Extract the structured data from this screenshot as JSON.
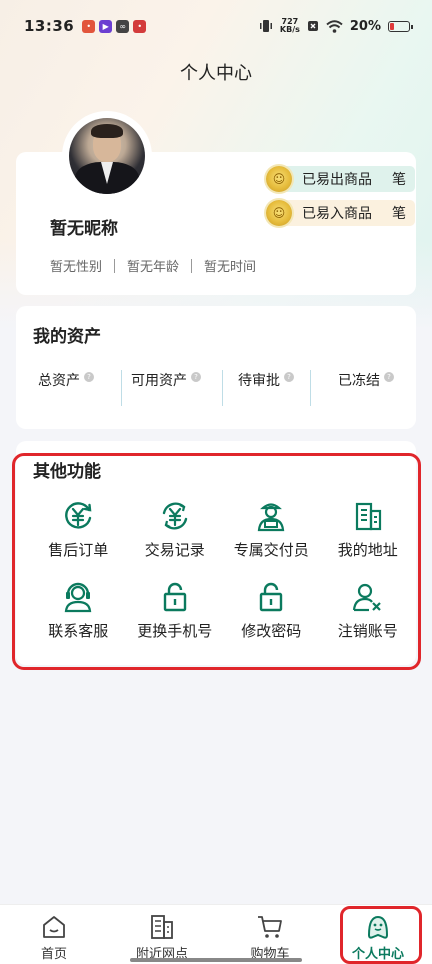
{
  "status_bar": {
    "time": "13:36",
    "net_speed_value": "727",
    "net_speed_unit": "KB/s",
    "battery": "20%",
    "apps": [
      {
        "icon": "app-red-icon",
        "color": "#e2553c"
      },
      {
        "icon": "app-play-icon",
        "color": "#6b3fd1"
      },
      {
        "icon": "app-link-icon",
        "color": "#444444"
      },
      {
        "icon": "app-red2-icon",
        "color": "#d33b3b"
      }
    ]
  },
  "page": {
    "title": "个人中心"
  },
  "profile": {
    "nickname": "暂无昵称",
    "gender": "暂无性别",
    "age": "暂无年龄",
    "time": "暂无时间",
    "sold": {
      "label": "已易出商品",
      "unit": "笔"
    },
    "bought": {
      "label": "已易入商品",
      "unit": "笔"
    }
  },
  "assets": {
    "title": "我的资产",
    "items": [
      {
        "label": "总资产"
      },
      {
        "label": "可用资产"
      },
      {
        "label": "待审批"
      },
      {
        "label": "已冻结"
      }
    ]
  },
  "functions": {
    "title": "其他功能",
    "items": [
      {
        "label": "售后订单",
        "icon": "yuan-refund-icon"
      },
      {
        "label": "交易记录",
        "icon": "yuan-cycle-icon"
      },
      {
        "label": "专属交付员",
        "icon": "courier-icon"
      },
      {
        "label": "我的地址",
        "icon": "building-icon"
      },
      {
        "label": "联系客服",
        "icon": "headset-icon"
      },
      {
        "label": "更换手机号",
        "icon": "lock-icon"
      },
      {
        "label": "修改密码",
        "icon": "lock-icon"
      },
      {
        "label": "注销账号",
        "icon": "user-remove-icon"
      }
    ]
  },
  "bottom_nav": {
    "items": [
      {
        "label": "首页",
        "icon": "home-icon"
      },
      {
        "label": "附近网点",
        "icon": "building-icon"
      },
      {
        "label": "购物车",
        "icon": "cart-icon"
      },
      {
        "label": "个人中心",
        "icon": "person-icon"
      }
    ],
    "active": "个人中心"
  },
  "colors": {
    "accent": "#0b7a5e",
    "highlight": "#e0262b"
  }
}
